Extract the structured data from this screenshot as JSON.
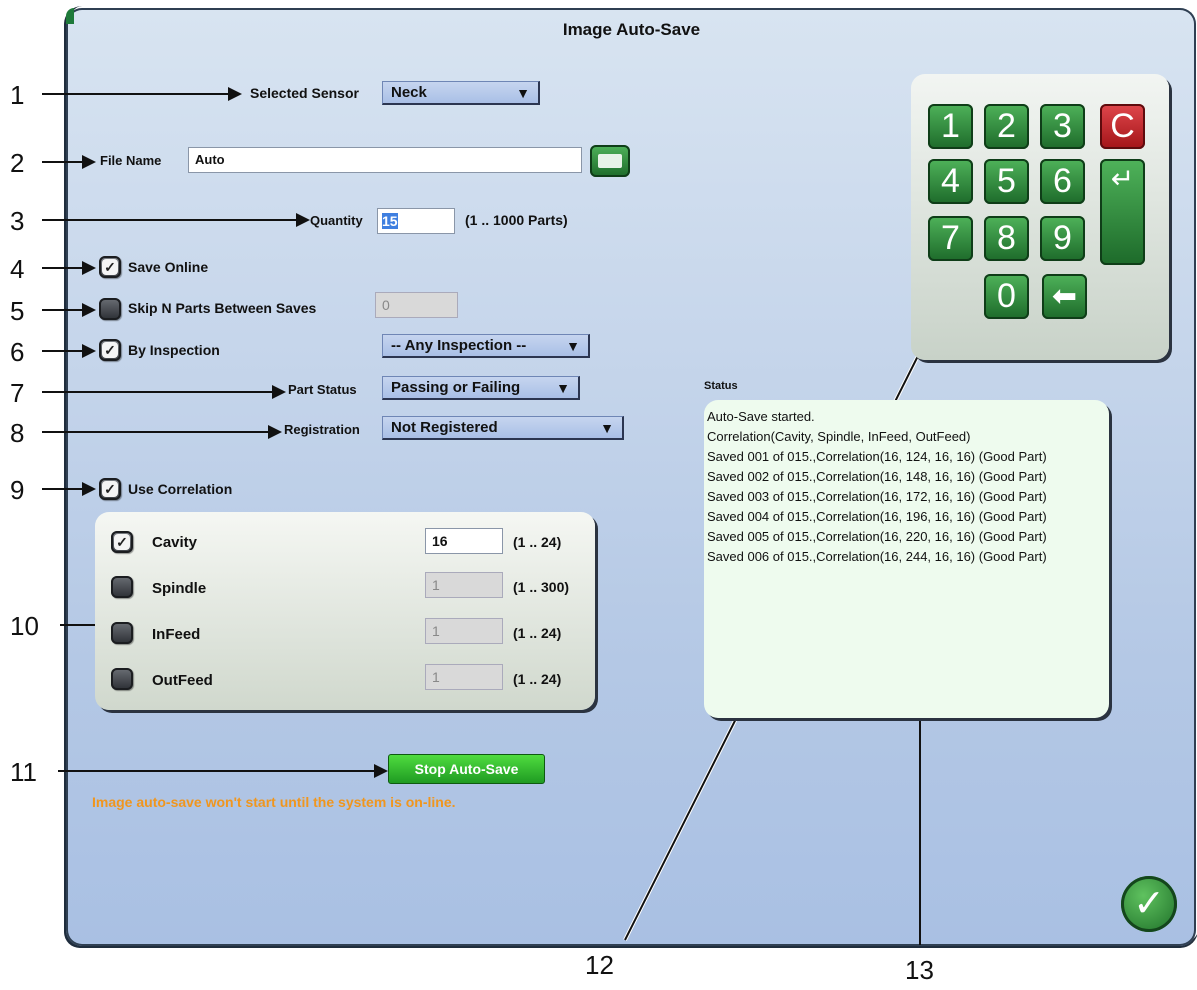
{
  "title": "Image Auto-Save",
  "callouts": [
    "1",
    "2",
    "3",
    "4",
    "5",
    "6",
    "7",
    "8",
    "9",
    "10",
    "11",
    "12",
    "13"
  ],
  "fields": {
    "selected_sensor_label": "Selected Sensor",
    "selected_sensor_value": "Neck",
    "file_name_label": "File Name",
    "file_name_value": "Auto",
    "quantity_label": "Quantity",
    "quantity_value": "15",
    "quantity_range": "(1 .. 1000 Parts)",
    "save_online_label": "Save Online",
    "skip_label": "Skip N Parts Between Saves",
    "skip_value": "0",
    "by_inspection_label": "By Inspection",
    "by_inspection_value": "-- Any Inspection --",
    "part_status_label": "Part Status",
    "part_status_value": "Passing or Failing",
    "registration_label": "Registration",
    "registration_value": "Not Registered",
    "use_correlation_label": "Use Correlation"
  },
  "correlation": [
    {
      "label": "Cavity",
      "value": "16",
      "range": "(1 .. 24)",
      "checked": true
    },
    {
      "label": "Spindle",
      "value": "1",
      "range": "(1 .. 300)",
      "checked": false
    },
    {
      "label": "InFeed",
      "value": "1",
      "range": "(1 .. 24)",
      "checked": false
    },
    {
      "label": "OutFeed",
      "value": "1",
      "range": "(1 .. 24)",
      "checked": false
    }
  ],
  "stop_button": "Stop Auto-Save",
  "warning": "Image auto-save won't start until the system is on-line.",
  "status_label": "Status",
  "status_lines": [
    "Auto-Save started.",
    "Correlation(Cavity, Spindle, InFeed, OutFeed)",
    "Saved 001 of 015.,Correlation(16, 124, 16, 16) (Good Part)",
    "Saved 002 of 015.,Correlation(16, 148, 16, 16) (Good Part)",
    "Saved 003 of 015.,Correlation(16, 172, 16, 16) (Good Part)",
    "Saved 004 of 015.,Correlation(16, 196, 16, 16) (Good Part)",
    "Saved 005 of 015.,Correlation(16, 220, 16, 16) (Good Part)",
    "Saved 006 of 015.,Correlation(16, 244, 16, 16) (Good Part)"
  ],
  "keypad": {
    "k1": "1",
    "k2": "2",
    "k3": "3",
    "clear": "C",
    "k4": "4",
    "k5": "5",
    "k6": "6",
    "k7": "7",
    "k8": "8",
    "k9": "9",
    "k0": "0"
  },
  "icons": {
    "keyboard": "keyboard-icon",
    "enter": "enter-icon",
    "backspace": "backspace-icon",
    "ok": "checkmark-icon",
    "dropdown": "triangle-down-icon",
    "check": "checkbox-check-icon"
  }
}
